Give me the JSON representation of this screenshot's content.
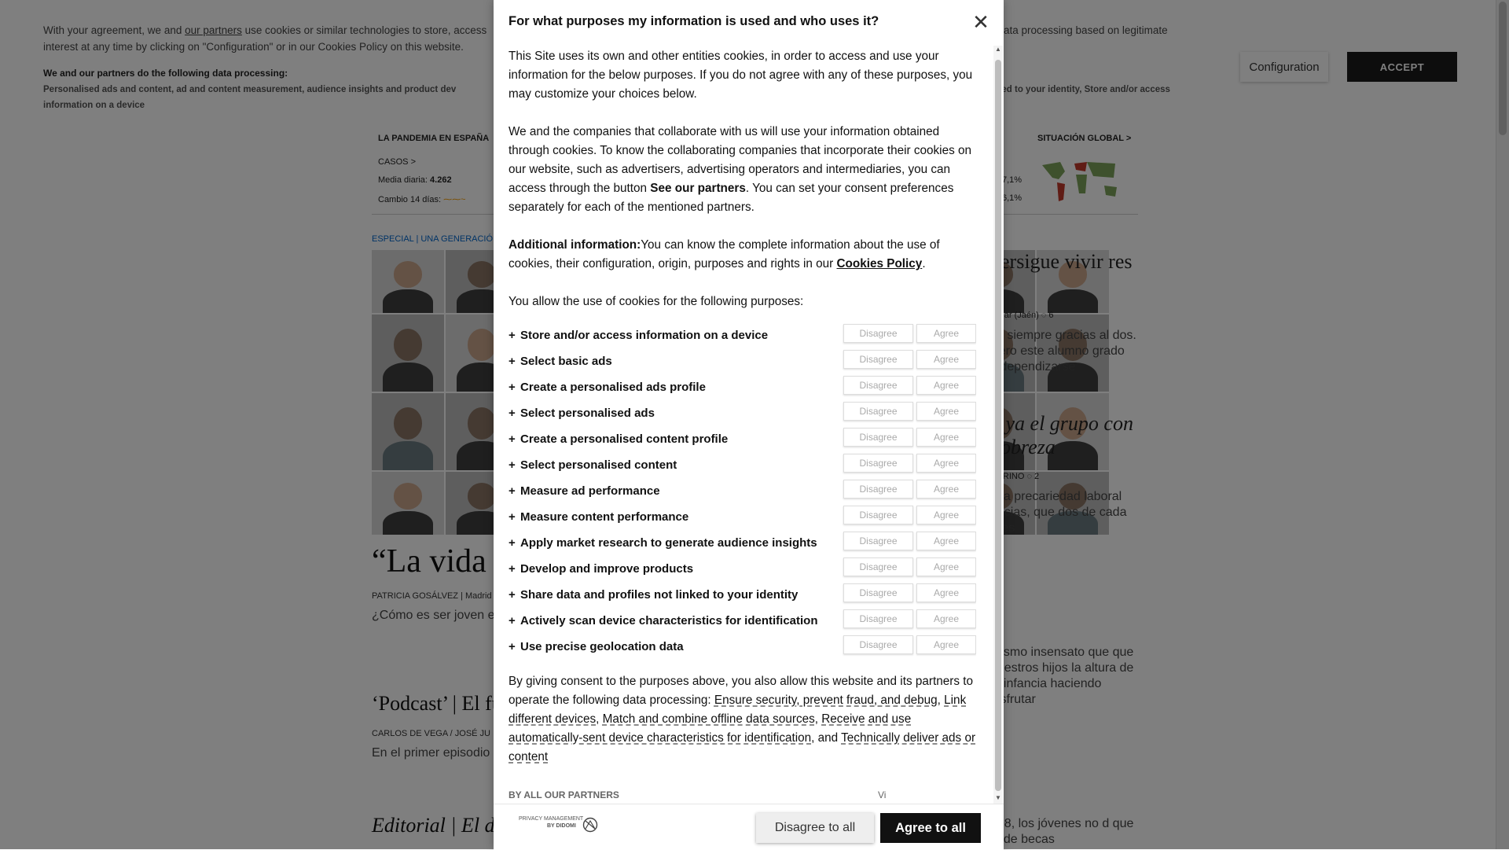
{
  "banner": {
    "intro_prefix": "With your agreement, we and ",
    "partners_link": "our partners",
    "intro_suffix": " use cookies or similar technologies to store, access",
    "intro_tail": "ata processing based on legitimate",
    "intro_line2": "interest at any time by clicking on \"Configuration\" or in our Cookies Policy on this website.",
    "processing_title": "We and our partners do the following data processing:",
    "processing_left": "Personalised ads and content, ad and content measurement, audience insights and product dev",
    "processing_right": "ked to your identity, Store and/or access",
    "processing_line2": "information on a device",
    "configuration_label": "Configuration",
    "accept_label": "ACCEPT"
  },
  "background": {
    "covid_title": "LA PANDEMIA EN ESPAÑA",
    "covid_global": "SITUACIÓN GLOBAL >",
    "casos": "CASOS >",
    "media_label": "Media diaria: ",
    "media_value": "4.262",
    "cambio_label": "Cambio 14 días:",
    "pct1": "7,1%",
    "pct2": "6,1%",
    "kicker": "ESPECIAL | UNA GENERACIÓ",
    "headline_a": "“La vida n",
    "byline_a": "PATRICIA GOSÁLVEZ | Madrid",
    "summary_a": "¿Cómo es ser joven en respondieron con un analiza cómo recuper",
    "headline_b": "‘Podcast’ | El fu",
    "byline_b": "CARLOS DE VEGA /  JOSÉ JU",
    "summary_b": "En el primer episodio falta de futuro y el te",
    "headline_c": "Editorial | El der",
    "right_h1": "persigue vivir res",
    "right_by1": "Jódar (Jaén)  ◌ 6",
    "right_s1": "fió siempre gracias al dos. Pero este alumno grado independizarse",
    "right_h2": "n ya el grupo con pobreza",
    "right_by2": "NDRINO  ◌ 2",
    "right_s2": "a la precariedad laboral encias, que dos de cada dres",
    "right_k3": "RO",
    "right_s3": "mismo insensato que que nuestros hijos la altura de la infancia haciendo disfrutar",
    "right_k4": "RO",
    "right_h4": "o",
    "right_s4": "008, los jóvenes no d que la de becas"
  },
  "modal": {
    "title": "For what purposes my information is used and who uses it?",
    "para1": "This Site uses its own and other entities cookies, in order to access and use your information for the below purposes. If you do not agree with any of these purposes, you may customize your choices below.",
    "para2_prefix": "We and the companies that collaborate with us will use your information obtained through cookies. To know the collaborating companies that incorporate their cookies on our website, such as advertisers, advertising operators and intermediaries, you can access through the button ",
    "para2_bold": "See our partners",
    "para2_suffix": ". You can set your consent preferences separately for each of the mentioned partners.",
    "para3_bold": "Additional information:",
    "para3_text": "You can know the complete information about the use of cookies, their configuration, origin, purposes and rights in our ",
    "cookies_policy_link": "Cookies Policy",
    "period": ".",
    "allow_text": "You allow the use of cookies for the following purposes:",
    "disagree_label": "Disagree",
    "agree_label": "Agree",
    "purposes": [
      "Store and/or access information on a device",
      "Select basic ads",
      "Create a personalised ads profile",
      "Select personalised ads",
      "Create a personalised content profile",
      "Select personalised content",
      "Measure ad performance",
      "Measure content performance",
      "Apply market research to generate audience insights",
      "Develop and improve products",
      "Share data and profiles not linked to your identity",
      "Actively scan device characteristics for identification",
      "Use precise geolocation data"
    ],
    "consent_prefix": "By giving consent to the purposes above, you also allow this website and its partners to operate the following data processing: ",
    "proc1": "Ensure security, prevent fraud, and debug",
    "proc2": "Link different devices",
    "proc3": "Match and combine offline data sources",
    "proc4": "Receive and use automatically-sent device characteristics for identification",
    "proc5": "Technically deliver ads or content",
    "and_text": ", and ",
    "comma": ", ",
    "partners_label": "BY ALL OUR PARTNERS",
    "view_label": "Vi"
  },
  "footer": {
    "didomi_line1": "PRIVACY MANAGEMENT",
    "didomi_line2": "BY DIDOMI",
    "disagree_all": "Disagree to all",
    "agree_all": "Agree to all"
  }
}
